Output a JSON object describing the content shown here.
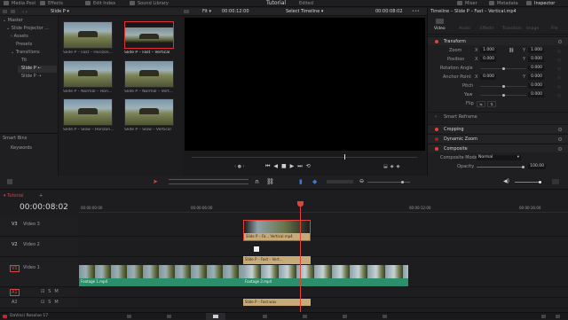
{
  "topbar": {
    "items": [
      "Media Pool",
      "Effects",
      "Edit Index",
      "Sound Library"
    ],
    "title": "Tutorial",
    "edited": "Edited",
    "right": [
      "Mixer",
      "Metadata",
      "Inspector"
    ]
  },
  "media_bar": {
    "bin": "Slide P",
    "fit": "Fit",
    "timecode1": "00:00:12:00",
    "timeline": "Select Timeline",
    "timecode2": "00:00:08:02"
  },
  "bins": {
    "items": [
      "Master",
      "Slide Projector ...",
      "Assets",
      "Presets",
      "Transitions",
      "Tit",
      "Slide P",
      "Slide P"
    ],
    "smart_bins": "Smart Bins",
    "keywords": "Keywords"
  },
  "clips": [
    {
      "label": "Slide P – Fast – Horizon..."
    },
    {
      "label": "Slide P – Fast – Vertical"
    },
    {
      "label": "Slide P – Normal – Hori..."
    },
    {
      "label": "Slide P – Normal – Vert..."
    },
    {
      "label": "Slide P – Slow – Horizon..."
    },
    {
      "label": "Slide P – Slow – Vertical"
    }
  ],
  "inspector": {
    "title": "Timeline – Slide P – Fast – Vertical.mp4",
    "tabs": [
      "Video",
      "Audio",
      "Effects",
      "Transition",
      "Image",
      "File"
    ],
    "transform": "Transform",
    "zoom_label": "Zoom",
    "zoom_x": "1.000",
    "zoom_y": "1.000",
    "position_label": "Position",
    "position_x": "0.000",
    "position_y": "0.000",
    "rotation_label": "Rotation Angle",
    "rotation": "0.000",
    "anchor_label": "Anchor Point",
    "anchor_x": "0.000",
    "anchor_y": "0.000",
    "pitch_label": "Pitch",
    "pitch": "0.000",
    "yaw_label": "Yaw",
    "yaw": "0.000",
    "flip_label": "Flip",
    "smart_reframe": "Smart Reframe",
    "cropping": "Cropping",
    "dynamic_zoom": "Dynamic Zoom",
    "composite": "Composite",
    "composite_mode_label": "Composite Mode",
    "composite_mode": "Normal",
    "opacity_label": "Opacity",
    "opacity": "100.00"
  },
  "timeline": {
    "tab": "Tutorial",
    "timecode": "00:00:08:02",
    "ruler": [
      "00:00:00:00",
      "00:00:06:00",
      "00:00:12:00",
      "00:00:16:00"
    ],
    "tracks": [
      {
        "id": "V3",
        "name": "Video 3"
      },
      {
        "id": "V2",
        "name": "Video 2"
      },
      {
        "id": "V1",
        "name": "Video 1"
      },
      {
        "id": "A1",
        "name": ""
      },
      {
        "id": "A2",
        "name": ""
      }
    ],
    "clips": {
      "v3": "Slide P – Fa... Vertical.mp4",
      "v2": "Slide P – Fast – Vert...",
      "v1a": "Footage 1.mp4",
      "v1b": "Footage 2.mp4",
      "a": "Slide P – Fast.wav"
    }
  },
  "footer": {
    "app": "DaVinci Resolve 17"
  },
  "colors": {
    "accent": "#e0433b",
    "clip_green": "#2a8f6a",
    "clip_tan": "#c7aa78",
    "playhead": "#e0433b"
  }
}
